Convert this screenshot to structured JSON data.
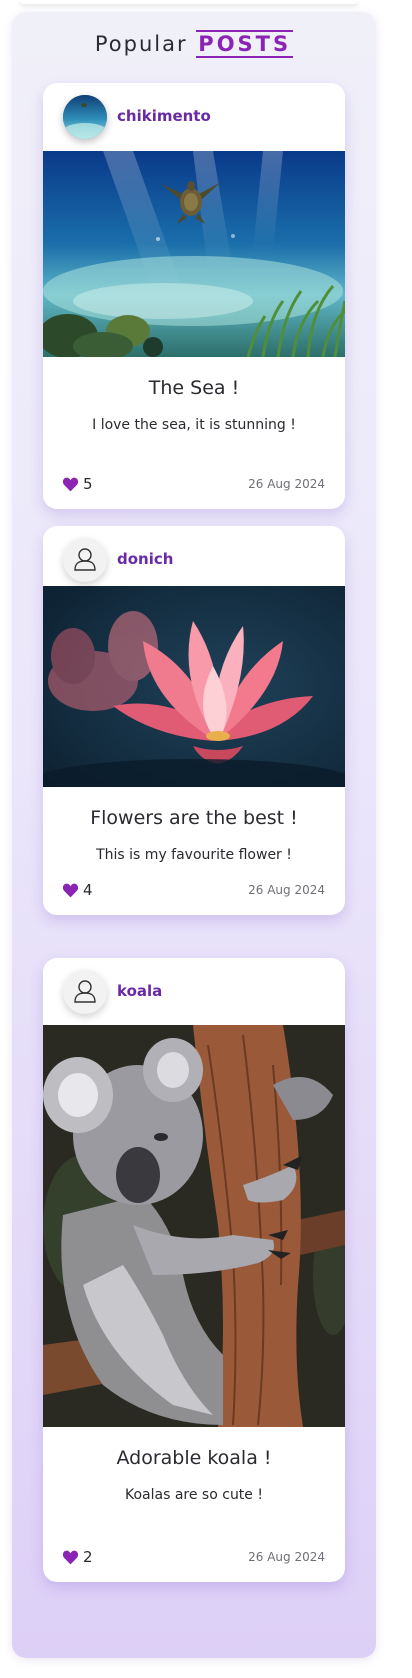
{
  "section": {
    "title_prefix": "Popular",
    "title_accent": "POSTS"
  },
  "colors": {
    "accent": "#8b24b4",
    "username": "#6a2aa6",
    "card_bg": "#ffffff"
  },
  "posts": [
    {
      "username": "chikimento",
      "avatar_type": "photo",
      "image": "sea-turtle-underwater",
      "title": "The Sea !",
      "text": "I love the sea, it is stunning !",
      "likes": "5",
      "date": "26 Aug 2024"
    },
    {
      "username": "donich",
      "avatar_type": "default-user-icon",
      "image": "pink-lotus-flower",
      "title": "Flowers are the best !",
      "text": "This is my favourite flower !",
      "likes": "4",
      "date": "26 Aug 2024"
    },
    {
      "username": "koala",
      "avatar_type": "default-user-icon",
      "image": "koala-hugging-tree",
      "title": "Adorable koala !",
      "text": "Koalas are so cute !",
      "likes": "2",
      "date": "26 Aug 2024"
    }
  ]
}
